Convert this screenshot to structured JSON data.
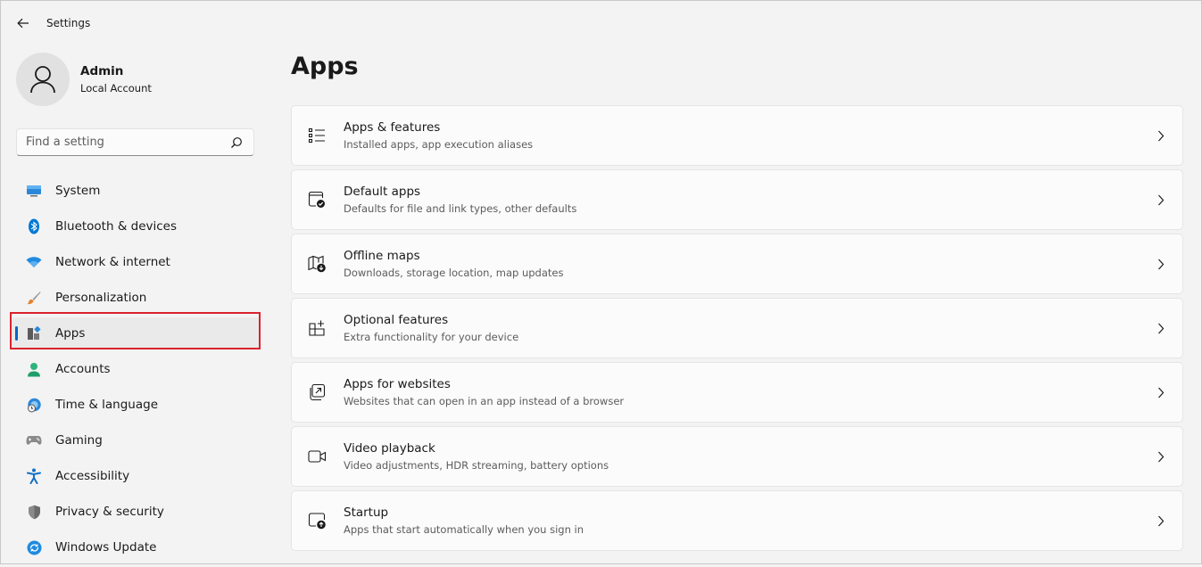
{
  "window": {
    "title": "Settings"
  },
  "profile": {
    "name": "Admin",
    "account_type": "Local Account"
  },
  "search": {
    "placeholder": "Find a setting"
  },
  "sidebar": {
    "items": [
      {
        "label": "System",
        "icon": "monitor-icon"
      },
      {
        "label": "Bluetooth & devices",
        "icon": "bluetooth-icon"
      },
      {
        "label": "Network & internet",
        "icon": "wifi-icon"
      },
      {
        "label": "Personalization",
        "icon": "brush-icon"
      },
      {
        "label": "Apps",
        "icon": "apps-icon",
        "selected": true
      },
      {
        "label": "Accounts",
        "icon": "person-icon"
      },
      {
        "label": "Time & language",
        "icon": "globe-clock-icon"
      },
      {
        "label": "Gaming",
        "icon": "gamepad-icon"
      },
      {
        "label": "Accessibility",
        "icon": "accessibility-icon"
      },
      {
        "label": "Privacy & security",
        "icon": "shield-icon"
      },
      {
        "label": "Windows Update",
        "icon": "update-icon"
      }
    ]
  },
  "main": {
    "title": "Apps",
    "cards": [
      {
        "title": "Apps & features",
        "subtitle": "Installed apps, app execution aliases",
        "icon": "list-icon"
      },
      {
        "title": "Default apps",
        "subtitle": "Defaults for file and link types, other defaults",
        "icon": "window-check-icon"
      },
      {
        "title": "Offline maps",
        "subtitle": "Downloads, storage location, map updates",
        "icon": "map-download-icon"
      },
      {
        "title": "Optional features",
        "subtitle": "Extra functionality for your device",
        "icon": "grid-plus-icon"
      },
      {
        "title": "Apps for websites",
        "subtitle": "Websites that can open in an app instead of a browser",
        "icon": "open-external-icon"
      },
      {
        "title": "Video playback",
        "subtitle": "Video adjustments, HDR streaming, battery options",
        "icon": "video-camera-icon"
      },
      {
        "title": "Startup",
        "subtitle": "Apps that start automatically when you sign in",
        "icon": "startup-icon"
      }
    ]
  },
  "colors": {
    "accent": "#0067c0",
    "highlight_border": "#d9232e",
    "background": "#f3f3f3",
    "card_background": "#fbfbfb"
  }
}
